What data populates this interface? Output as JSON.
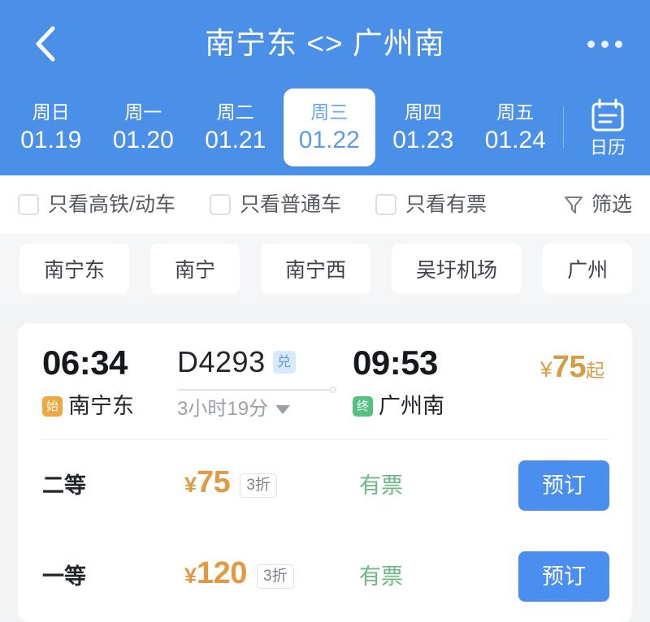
{
  "header": {
    "back_icon": "chevron-left-icon",
    "title": "南宁东 <> 广州南",
    "more_icon": "more-horizontal-icon",
    "dates": [
      {
        "dow": "周日",
        "date": "01.19",
        "active": false
      },
      {
        "dow": "周一",
        "date": "01.20",
        "active": false
      },
      {
        "dow": "周二",
        "date": "01.21",
        "active": false
      },
      {
        "dow": "周三",
        "date": "01.22",
        "active": true
      },
      {
        "dow": "周四",
        "date": "01.23",
        "active": false
      },
      {
        "dow": "周五",
        "date": "01.24",
        "active": false
      }
    ],
    "calendar": {
      "icon": "calendar-icon",
      "label": "日历"
    }
  },
  "filters": {
    "checkboxes": [
      {
        "label": "只看高铁/动车",
        "checked": false
      },
      {
        "label": "只看普通车",
        "checked": false
      },
      {
        "label": "只看有票",
        "checked": false
      }
    ],
    "filter_button": {
      "icon": "funnel-icon",
      "label": "筛选"
    }
  },
  "station_chips": [
    "南宁东",
    "南宁",
    "南宁西",
    "吴圩机场",
    "广州"
  ],
  "train": {
    "depart_time": "06:34",
    "depart_station": "南宁东",
    "depart_tag": "始",
    "arrive_time": "09:53",
    "arrive_station": "广州南",
    "arrive_tag": "终",
    "train_no": "D4293",
    "exchange_badge": "兑",
    "duration": "3小时19分",
    "expand_icon": "caret-down-icon",
    "price_currency": "¥",
    "price_from_value": "75",
    "price_from_suffix": "起",
    "seats": [
      {
        "name": "二等",
        "currency": "¥",
        "price": "75",
        "discount": "3折",
        "stock": "有票",
        "book_label": "预订"
      },
      {
        "name": "一等",
        "currency": "¥",
        "price": "120",
        "discount": "3折",
        "stock": "有票",
        "book_label": "预订"
      }
    ]
  },
  "colors": {
    "brand_blue": "#4a90e8",
    "button_blue": "#4a8ef0",
    "price_orange": "#e09a43",
    "stock_green": "#6cb884",
    "start_tag": "#efa741",
    "end_tag": "#55c07f"
  }
}
